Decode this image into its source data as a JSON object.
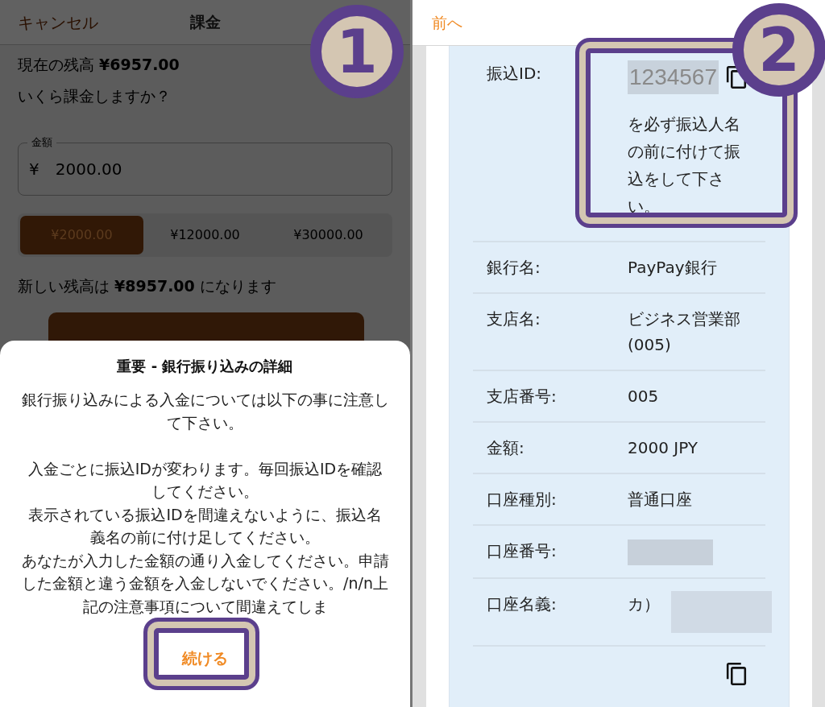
{
  "left_screen": {
    "header": {
      "cancel": "キャンセル",
      "title": "課金"
    },
    "current_balance": "現在の残高 **¥6957.00**",
    "question": "いくら課金しますか？",
    "amount_field": {
      "label": "金額",
      "currency": "¥",
      "value": "2000.00"
    },
    "presets": [
      {
        "label": "¥2000.00",
        "selected": true
      },
      {
        "label": "¥12000.00",
        "selected": false
      },
      {
        "label": "¥30000.00",
        "selected": false
      }
    ],
    "new_balance": "新しい残高は **¥8957.00** になります",
    "dialog": {
      "title": "重要 - 銀行振り込みの詳細",
      "paragraphs": [
        "銀行振り込みによる入金については以下の事に注意して下さい。",
        "入金ごとに振込IDが変わります。毎回振込IDを確認してください。",
        "表示されている振込IDを間違えないように、振込名義名の前に付け足してください。",
        "あなたが入力した金額の通り入金してください。申請した金額と違う金額を入金しないでください。/n/n上記の注意事項について間違えてしま"
      ],
      "continue_button": "続ける"
    }
  },
  "right_screen": {
    "back": "前へ",
    "transfer_id": {
      "label": "振込ID:",
      "id": "1234567",
      "note": "を必ず振込人名の前に付けて振込をして下さい。"
    },
    "details": [
      {
        "label": "銀行名:",
        "value": "PayPay銀行",
        "redacted": false
      },
      {
        "label": "支店名:",
        "value": "ビジネス営業部(005)",
        "redacted": false
      },
      {
        "label": "支店番号:",
        "value": "005",
        "redacted": false
      },
      {
        "label": "金額:",
        "value": "2000 JPY",
        "redacted": false
      },
      {
        "label": "口座種別:",
        "value": "普通口座",
        "redacted": false
      },
      {
        "label": "口座番号:",
        "redacted": true
      },
      {
        "label": "口座名義:",
        "value": "カ）",
        "redacted": true
      }
    ]
  },
  "annotations": [
    {
      "label": "1"
    },
    {
      "label": "2"
    }
  ]
}
